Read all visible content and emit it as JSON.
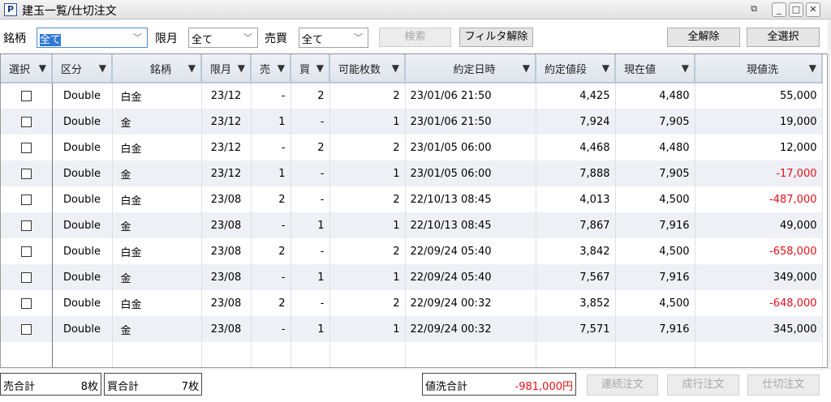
{
  "window": {
    "title": "建玉一覧/仕切注文",
    "icon_letter": "P"
  },
  "filters": {
    "meigara_label": "銘柄",
    "meigara_value": "全て",
    "gengetsu_label": "限月",
    "gengetsu_value": "全て",
    "baibai_label": "売買",
    "baibai_value": "全て"
  },
  "toolbar": {
    "search": "検索",
    "clear_filter": "フィルタ解除",
    "deselect_all": "全解除",
    "select_all": "全選択"
  },
  "columns": [
    "選択",
    "区分",
    "銘柄",
    "限月",
    "売",
    "買",
    "可能枚数",
    "約定日時",
    "約定値段",
    "現在値",
    "現値洗"
  ],
  "rows": [
    {
      "kubun": "Double",
      "meigara": "白金",
      "gengetsu": "23/12",
      "uri": "-",
      "kai": "2",
      "kanou": "2",
      "datetime": "23/01/06 21:50",
      "yakujo": "4,425",
      "genzai": "4,480",
      "arai": "55,000",
      "neg": false
    },
    {
      "kubun": "Double",
      "meigara": "金",
      "gengetsu": "23/12",
      "uri": "1",
      "kai": "-",
      "kanou": "1",
      "datetime": "23/01/06 21:50",
      "yakujo": "7,924",
      "genzai": "7,905",
      "arai": "19,000",
      "neg": false
    },
    {
      "kubun": "Double",
      "meigara": "白金",
      "gengetsu": "23/12",
      "uri": "-",
      "kai": "2",
      "kanou": "2",
      "datetime": "23/01/05 06:00",
      "yakujo": "4,468",
      "genzai": "4,480",
      "arai": "12,000",
      "neg": false
    },
    {
      "kubun": "Double",
      "meigara": "金",
      "gengetsu": "23/12",
      "uri": "1",
      "kai": "-",
      "kanou": "1",
      "datetime": "23/01/05 06:00",
      "yakujo": "7,888",
      "genzai": "7,905",
      "arai": "-17,000",
      "neg": true
    },
    {
      "kubun": "Double",
      "meigara": "白金",
      "gengetsu": "23/08",
      "uri": "2",
      "kai": "-",
      "kanou": "2",
      "datetime": "22/10/13 08:45",
      "yakujo": "4,013",
      "genzai": "4,500",
      "arai": "-487,000",
      "neg": true
    },
    {
      "kubun": "Double",
      "meigara": "金",
      "gengetsu": "23/08",
      "uri": "-",
      "kai": "1",
      "kanou": "1",
      "datetime": "22/10/13 08:45",
      "yakujo": "7,867",
      "genzai": "7,916",
      "arai": "49,000",
      "neg": false
    },
    {
      "kubun": "Double",
      "meigara": "白金",
      "gengetsu": "23/08",
      "uri": "2",
      "kai": "-",
      "kanou": "2",
      "datetime": "22/09/24 05:40",
      "yakujo": "3,842",
      "genzai": "4,500",
      "arai": "-658,000",
      "neg": true
    },
    {
      "kubun": "Double",
      "meigara": "金",
      "gengetsu": "23/08",
      "uri": "-",
      "kai": "1",
      "kanou": "1",
      "datetime": "22/09/24 05:40",
      "yakujo": "7,567",
      "genzai": "7,916",
      "arai": "349,000",
      "neg": false
    },
    {
      "kubun": "Double",
      "meigara": "白金",
      "gengetsu": "23/08",
      "uri": "2",
      "kai": "-",
      "kanou": "2",
      "datetime": "22/09/24 00:32",
      "yakujo": "3,852",
      "genzai": "4,500",
      "arai": "-648,000",
      "neg": true
    },
    {
      "kubun": "Double",
      "meigara": "金",
      "gengetsu": "23/08",
      "uri": "-",
      "kai": "1",
      "kanou": "1",
      "datetime": "22/09/24 00:32",
      "yakujo": "7,571",
      "genzai": "7,916",
      "arai": "345,000",
      "neg": false
    }
  ],
  "footer": {
    "sell_total_label": "売合計",
    "sell_total": "8枚",
    "buy_total_label": "買合計",
    "buy_total": "7枚",
    "pl_total_label": "値洗合計",
    "pl_total": "-981,000円",
    "renzoku": "連続注文",
    "nariyuki": "成行注文",
    "shikiri": "仕切注文"
  },
  "colors": {
    "negative": "#e8101a",
    "header": "#dfe4ec",
    "alt_row": "#eef0f5"
  }
}
